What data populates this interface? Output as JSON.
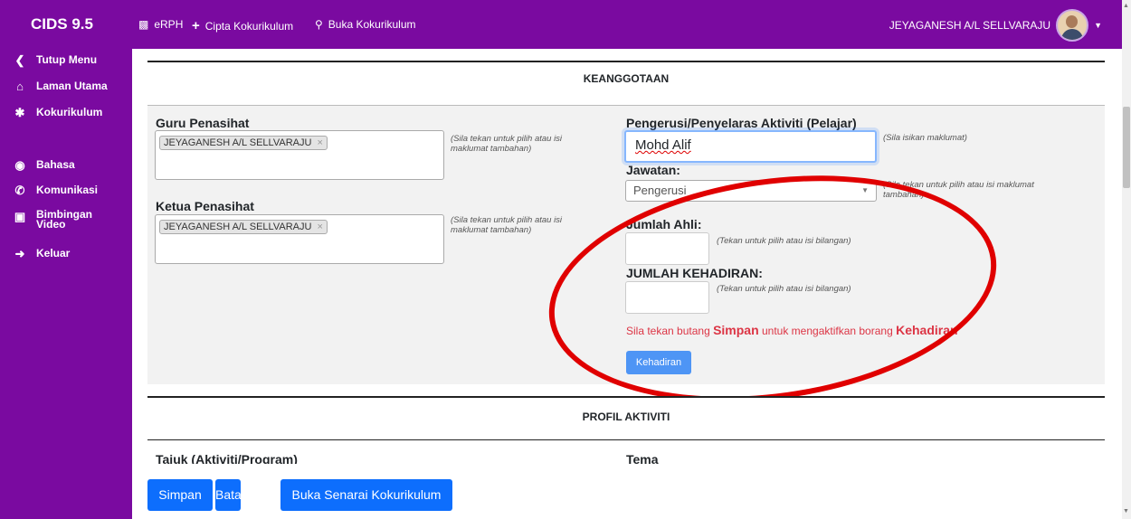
{
  "app": {
    "title": "CIDS 9.5"
  },
  "nav": {
    "links": [
      {
        "label": "eRPH",
        "icon": "file-icon"
      },
      {
        "label": "Cipta Kokurikulum",
        "icon": "plus-icon"
      },
      {
        "label": "Buka Kokurikulum",
        "icon": "search-icon"
      }
    ],
    "user": "JEYAGANESH A/L SELLVARAJU"
  },
  "sidebar": {
    "items": [
      {
        "label": "Tutup Menu",
        "icon": "chevron-left-circle-icon"
      },
      {
        "label": "Laman Utama",
        "icon": "home-icon"
      },
      {
        "label": "Kokurikulum",
        "icon": "running-icon"
      },
      {
        "label": "Bahasa",
        "icon": "globe-icon"
      },
      {
        "label": "Komunikasi",
        "icon": "phone-icon"
      },
      {
        "label": "Bimbingan Video",
        "icon": "video-icon"
      },
      {
        "label": "Keluar",
        "icon": "sign-out-icon"
      }
    ]
  },
  "keanggotaan": {
    "heading": "KEANGGOTAAN",
    "guru_label": "Guru Penasihat",
    "guru_tag": "JEYAGANESH A/L SELLVARAJU",
    "guru_note": "(Sila tekan untuk pilih atau isi maklumat tambahan)",
    "ketua_label": "Ketua Penasihat",
    "ketua_tag": "JEYAGANESH A/L SELLVARAJU",
    "ketua_note": "(Sila tekan untuk pilih atau isi maklumat tambahan)",
    "pengerusi_label": "Pengerusi/Penyelaras Aktiviti (Pelajar)",
    "pengerusi_value": "Mohd Alif",
    "pengerusi_note": "(Sila isikan maklumat)",
    "jawatan_label": "Jawatan:",
    "jawatan_value": "Pengerusi",
    "jawatan_note": "(Sila tekan untuk pilih atau isi maklumat tambahan)",
    "jumlah_ahli_label": "Jumlah Ahli:",
    "jumlah_ahli_note": "(Tekan untuk pilih atau isi bilangan)",
    "kehadiran_label": "JUMLAH KEHADIRAN:",
    "kehadiran_note": "(Tekan untuk pilih atau isi bilangan)",
    "warn_pre": "Sila tekan butang ",
    "warn_simpan": "Simpan",
    "warn_mid": " untuk mengaktifkan borang ",
    "warn_kehadiran": "Kehadiran",
    "kehadiran_button": "Kehadiran"
  },
  "profil": {
    "heading": "PROFIL AKTIVITI",
    "tajuk_label": "Tajuk (Aktiviti/Program)",
    "tema_label": "Tema"
  },
  "footer": {
    "simpan": "Simpan",
    "batal": "Batal",
    "senarai": "Buka Senarai Kokurikulum"
  },
  "colors": {
    "brand": "#7a0aa0",
    "primary": "#0d6efd",
    "danger": "#dc3545",
    "annotation": "#e00000"
  }
}
